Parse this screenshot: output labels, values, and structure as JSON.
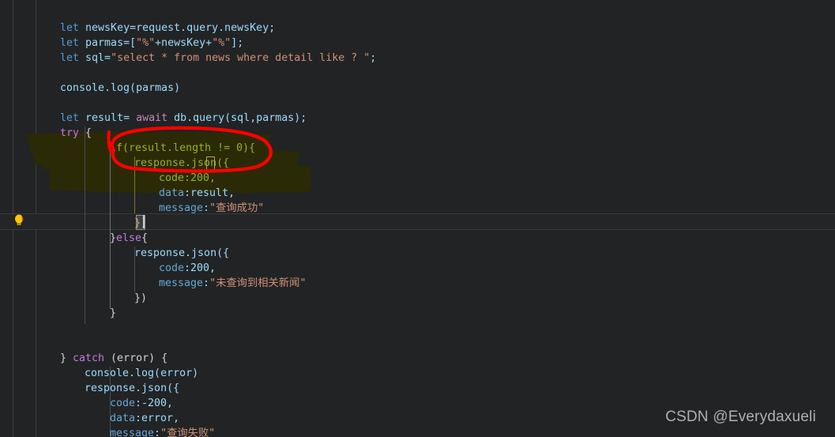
{
  "editor": {
    "title": "code-editor",
    "theme": "darcula-dark",
    "background_color": "#222324",
    "current_line_color": "#232526",
    "font_size_px": 13.3,
    "line_height_px": 19
  },
  "gutter": {
    "quickfix_icon": "lightbulb-icon",
    "quickfix_icon_color": "#ffc400"
  },
  "annotations": {
    "red_ellipse": {
      "shape": "hand-drawn-ellipse",
      "color": "#ff0000",
      "encircles": "if(result.length != 0){"
    },
    "marker_highlight": {
      "shape": "hand-drawn-marker-blob",
      "color": "#2b2a06",
      "covers": "if(result.length != 0){ ... code:200,"
    }
  },
  "watermark": {
    "text": "CSDN @Everydaxueli",
    "color": "#b9bdc0"
  },
  "code": {
    "lines": [
      {
        "indent": 1,
        "text": "let newsKey=request.query.newsKey;"
      },
      {
        "indent": 1,
        "text": "let parmas=[\"%\"+newsKey+\"%\"];"
      },
      {
        "indent": 1,
        "text": "let sql=\"select * from news where detail like ? \";"
      },
      {
        "indent": 0,
        "text": ""
      },
      {
        "indent": 1,
        "text": "console.log(parmas)"
      },
      {
        "indent": 0,
        "text": ""
      },
      {
        "indent": 1,
        "text": "let result= await db.query(sql,parmas);"
      },
      {
        "indent": 1,
        "text": "try {"
      },
      {
        "indent": 2,
        "text": "if(result.length != 0){"
      },
      {
        "indent": 3,
        "text": "response.json({"
      },
      {
        "indent": 4,
        "text": "code:200,"
      },
      {
        "indent": 4,
        "text": "data:result,"
      },
      {
        "indent": 4,
        "text": "message:\"查询成功\""
      },
      {
        "indent": 3,
        "text": "})"
      },
      {
        "indent": 2,
        "text": "}else{"
      },
      {
        "indent": 3,
        "text": "response.json({"
      },
      {
        "indent": 4,
        "text": "code:200,"
      },
      {
        "indent": 4,
        "text": "message:\"未查询到相关新闻\""
      },
      {
        "indent": 3,
        "text": "})"
      },
      {
        "indent": 2,
        "text": "}"
      },
      {
        "indent": 0,
        "text": ""
      },
      {
        "indent": 0,
        "text": ""
      },
      {
        "indent": 1,
        "text": "} catch (error) {"
      },
      {
        "indent": 2,
        "text": "console.log(error)"
      },
      {
        "indent": 2,
        "text": "response.json({"
      },
      {
        "indent": 3,
        "text": "code:-200,"
      },
      {
        "indent": 3,
        "text": "data:error,"
      },
      {
        "indent": 3,
        "text": "message:\"查询失败\""
      }
    ],
    "tokens": {
      "l1_let": "let",
      "l1_rest": " newsKey=request.query.newsKey;",
      "l2_let": "let",
      "l2_name": " parmas=[",
      "l2_s1": "\"%\"",
      "l2_plus": "+newsKey+",
      "l2_s2": "\"%\"",
      "l2_end": "];",
      "l3_let": "let",
      "l3_name": " sql=",
      "l3_sql": "\"select * from news where detail like ? \"",
      "l3_end": ";",
      "l5_console": "console.log(parmas)",
      "l7_let": "let",
      "l7_mid": " result= ",
      "l7_await": "await",
      "l7_end": " db.query(sql,parmas);",
      "l8_try": "try",
      "l8_brace": " {",
      "l9_if": "if",
      "l9_rest": "(result.length != 0){",
      "l10_call": "response.json(",
      "l10_brace": "{",
      "l11_key": "code",
      "l11_val": ":200,",
      "l12_key": "data",
      "l12_val": ":result,",
      "l13_key": "message",
      "l13_colon": ":",
      "l13_str": "\"查询成功\"",
      "l14_close": "})",
      "l15_else_a": "}",
      "l15_else_b": "else",
      "l15_else_c": "{",
      "l16_call": "response.json({",
      "l17_key": "code",
      "l17_val": ":200,",
      "l18_key": "message",
      "l18_colon": ":",
      "l18_str": "\"未查询到相关新闻\"",
      "l19_close": "})",
      "l20_close": "}",
      "l23_a": "} ",
      "l23_catch": "catch",
      "l23_b": " (error) {",
      "l24_console": "console.log(error)",
      "l25_call": "response.json({",
      "l26_key": "code",
      "l26_val": ":-200,",
      "l27_key": "data",
      "l27_val": ":error,",
      "l28_key": "message",
      "l28_colon": ":",
      "l28_str": "\"查询失败\""
    }
  }
}
